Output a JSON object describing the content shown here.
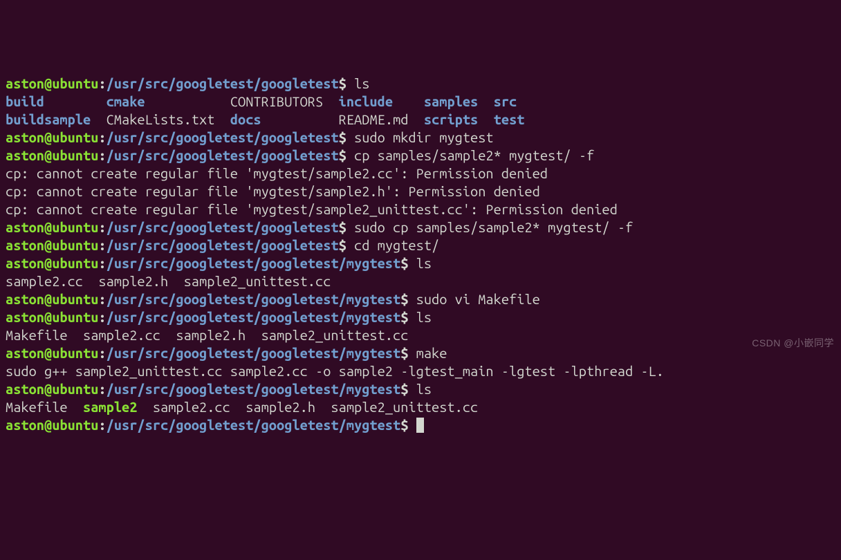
{
  "prompt": {
    "user": "aston",
    "host": "ubuntu",
    "at": "@",
    "colon": ":",
    "dollar": "$"
  },
  "paths": {
    "gtest": "/usr/src/googletest/googletest",
    "mygtest": "/usr/src/googletest/googletest/mygtest"
  },
  "cmds": {
    "ls": "ls",
    "mkdir": "sudo mkdir mygtest",
    "cp": "cp samples/sample2* mygtest/ -f",
    "sudo_cp": "sudo cp samples/sample2* mygtest/ -f",
    "cd": "cd mygtest/",
    "vi": "sudo vi Makefile",
    "make": "make"
  },
  "ls1": {
    "build": "build",
    "cmake": "cmake",
    "contributors": "CONTRIBUTORS",
    "include": "include",
    "samples": "samples",
    "src": "src",
    "buildsample": "buildsample",
    "cmakelists": "CMakeLists.txt",
    "docs": "docs",
    "readme": "README.md",
    "scripts": "scripts",
    "test": "test"
  },
  "cp_err": {
    "l1": "cp: cannot create regular file 'mygtest/sample2.cc': Permission denied",
    "l2": "cp: cannot create regular file 'mygtest/sample2.h': Permission denied",
    "l3": "cp: cannot create regular file 'mygtest/sample2_unittest.cc': Permission denied"
  },
  "ls2": "sample2.cc  sample2.h  sample2_unittest.cc",
  "ls3": "Makefile  sample2.cc  sample2.h  sample2_unittest.cc",
  "make_out": "sudo g++ sample2_unittest.cc sample2.cc -o sample2 -lgtest_main -lgtest -lpthread -L.",
  "ls4": {
    "makefile": "Makefile",
    "sample2": "sample2",
    "rest": "sample2.cc  sample2.h  sample2_unittest.cc"
  },
  "watermark": "CSDN @小嵌同学"
}
